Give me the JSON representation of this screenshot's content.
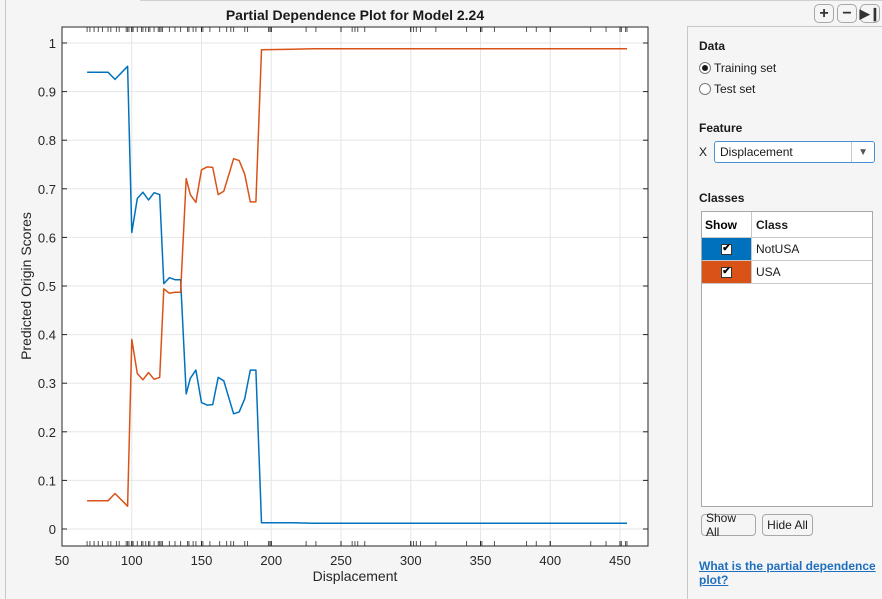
{
  "toolbar": {
    "zoom_in_icon": "plus-icon",
    "zoom_out_icon": "minus-icon",
    "collapse_icon": "panel-collapse-icon",
    "zoom_in_label": "+",
    "zoom_out_label": "−",
    "collapse_label": "▶❙"
  },
  "panel": {
    "data_title": "Data",
    "data_options": [
      {
        "label": "Training set",
        "selected": true
      },
      {
        "label": "Test set",
        "selected": false
      }
    ],
    "feature_title": "Feature",
    "feature_axis_label": "X",
    "feature_value": "Displacement",
    "classes_title": "Classes",
    "table_headers": [
      "Show",
      "Class"
    ],
    "classes": [
      {
        "name": "NotUSA",
        "shown": true,
        "color": "#0072bd"
      },
      {
        "name": "USA",
        "shown": true,
        "color": "#d95319"
      }
    ],
    "show_all_label": "Show All",
    "hide_all_label": "Hide All",
    "help_link": "What is the partial dependence plot?"
  },
  "chart_data": {
    "type": "line",
    "title": "Partial Dependence Plot for Model 2.24",
    "xlabel": "Displacement",
    "ylabel": "Predicted Origin Scores",
    "xlim": [
      50,
      470
    ],
    "ylim": [
      -0.035,
      1.03
    ],
    "xticks": [
      50,
      100,
      150,
      200,
      250,
      300,
      350,
      400,
      450
    ],
    "yticks": [
      0,
      0.1,
      0.2,
      0.3,
      0.4,
      0.5,
      0.6,
      0.7,
      0.8,
      0.9,
      1
    ],
    "ytick_labels": [
      "0",
      "0.1",
      "0.2",
      "0.3",
      "0.4",
      "0.5",
      "0.6",
      "0.7",
      "0.8",
      "0.9",
      "1"
    ],
    "grid": true,
    "x": [
      68,
      83,
      88,
      97,
      100,
      104,
      108,
      112,
      116,
      120,
      123,
      127,
      131,
      135,
      139,
      142,
      146,
      150,
      154,
      158,
      162,
      166,
      170,
      173,
      177,
      181,
      185,
      189,
      193,
      215,
      230,
      455
    ],
    "series": [
      {
        "name": "NotUSA",
        "color": "#0072bd",
        "values": [
          0.94,
          0.94,
          0.925,
          0.952,
          0.61,
          0.68,
          0.693,
          0.677,
          0.692,
          0.688,
          0.505,
          0.517,
          0.513,
          0.513,
          0.278,
          0.31,
          0.327,
          0.26,
          0.255,
          0.256,
          0.312,
          0.305,
          0.266,
          0.237,
          0.241,
          0.268,
          0.327,
          0.327,
          0.013,
          0.013,
          0.012,
          0.012
        ]
      },
      {
        "name": "USA",
        "color": "#d95319",
        "values": [
          0.058,
          0.058,
          0.073,
          0.047,
          0.39,
          0.32,
          0.307,
          0.322,
          0.308,
          0.312,
          0.494,
          0.485,
          0.487,
          0.487,
          0.721,
          0.688,
          0.672,
          0.739,
          0.745,
          0.744,
          0.688,
          0.695,
          0.733,
          0.762,
          0.758,
          0.73,
          0.673,
          0.673,
          0.986,
          0.987,
          0.988,
          0.988
        ]
      }
    ],
    "rug_x": [
      68,
      70,
      73,
      76,
      79,
      83,
      85,
      89,
      91,
      96,
      97,
      98,
      100,
      101,
      104,
      107,
      108,
      110,
      112,
      113,
      116,
      119,
      120,
      121,
      122,
      127,
      131,
      135,
      140,
      141,
      144,
      146,
      151,
      156,
      163,
      168,
      171,
      173,
      181,
      183,
      198,
      199,
      200,
      225,
      232,
      250,
      258,
      260,
      262,
      267,
      300,
      302,
      304,
      307,
      318,
      340,
      351,
      360,
      383,
      390,
      400,
      429,
      440,
      451,
      454,
      455
    ]
  }
}
